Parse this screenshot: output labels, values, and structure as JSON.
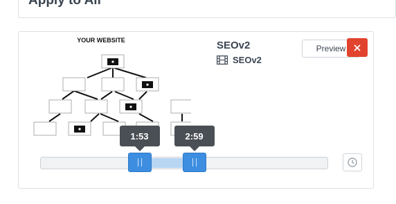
{
  "previous_panel": {
    "title": "Apply to All"
  },
  "thumbnail": {
    "heading": "YOUR WEBSITE",
    "icon": "site-tree-diagram"
  },
  "video": {
    "title": "SEOv2",
    "subtitle": "SEOv2",
    "subtitle_icon": "film-icon"
  },
  "buttons": {
    "preview_label": "Preview",
    "close_icon": "close-icon",
    "history_icon": "clock-icon"
  },
  "slider": {
    "start_label": "1:53",
    "end_label": "2:59",
    "start_fraction": 0.345,
    "end_fraction": 0.535
  },
  "colors": {
    "accent": "#3d8ee0",
    "range": "#b8d6f2",
    "danger": "#e2432e",
    "tooltip": "#4a4f55"
  }
}
